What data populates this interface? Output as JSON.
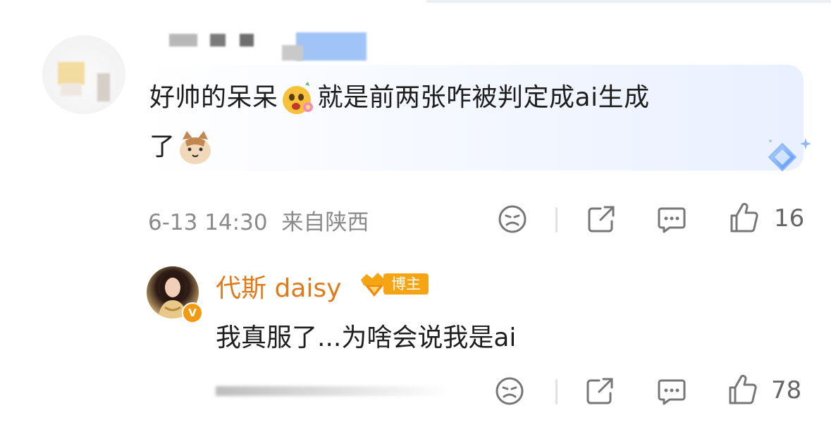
{
  "comment": {
    "text_part1": "好帅的呆呆",
    "emoji1": "smiling-face-with-flower-icon",
    "text_part2": "就是前两张咋被判定成ai生成",
    "text_part3": "了",
    "emoji2": "cat-face-icon",
    "time": "6-13 14:30",
    "location": "来自陕西",
    "like_count": "16"
  },
  "reply": {
    "author": "代斯 daisy",
    "badge_label": "博主",
    "text": "我真服了...为啥会说我是ai",
    "like_count": "78"
  },
  "colors": {
    "accent_name": "#e07a1a",
    "badge": "#f5a413",
    "meta": "#8a8a8a"
  }
}
